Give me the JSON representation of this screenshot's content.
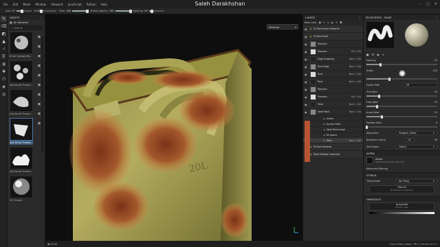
{
  "app": {
    "title": "Saleh Darakhshan",
    "menu": [
      "File",
      "Edit",
      "Mode",
      "Window",
      "Viewport",
      "JavaScript",
      "Python",
      "Help"
    ],
    "window_controls": [
      "–",
      "□",
      "✕"
    ]
  },
  "toolbar": {
    "fields": [
      {
        "label": "Size",
        "value": "27",
        "fill": 0.35
      },
      {
        "label": "",
        "value": "0.00",
        "fill": 0.0
      },
      {
        "label": "Flow",
        "value": "100",
        "fill": 1.0
      },
      {
        "label": "Stroke opacity",
        "value": "100",
        "fill": 1.0
      },
      {
        "label": "Spacing",
        "value": "20",
        "fill": 0.2
      }
    ]
  },
  "tools": [
    "brush-icon",
    "eraser-icon",
    "projection-icon",
    "geometry-fill-icon",
    "smudge-icon",
    "clone-icon",
    "fill-icon",
    "picker-icon",
    "polygon-fill-icon",
    "color-picker-icon",
    "material-picker-icon"
  ],
  "assets": {
    "title": "ASSETS",
    "library": "All libraries",
    "search": "Search",
    "items": [
      {
        "caption": "Brush Sponge Wisps..."
      },
      {
        "caption": "Kyle Brush Presets at..."
      },
      {
        "caption": "Kyle Brush Presets at..."
      },
      {
        "caption": "Kyle Brush Presets at..."
      },
      {
        "caption": "Kyle Brush Presets at..."
      },
      {
        "caption": "02 Chrome"
      }
    ],
    "selected_index": 3
  },
  "viewport": {
    "dropdown": "Material",
    "status_left": "▣ MASK",
    "status_right": "Cache Disk Usage:   78% | Version: 8.3.1"
  },
  "layers": {
    "title": "LAYERS",
    "blend_label": "Base color",
    "rows": [
      {
        "name": "02 Rust Smart Material",
        "blend": "",
        "opacity": "",
        "type": "group"
      },
      {
        "name": "03 Rust Paint",
        "blend": "",
        "opacity": "",
        "type": "group"
      },
      {
        "name": "Sharpen",
        "blend": "",
        "opacity": "",
        "type": "layer"
      },
      {
        "name": "Sharpen",
        "blend": "Mul",
        "opacity": "100",
        "type": "layer"
      },
      {
        "name": "Edge Bubbling",
        "blend": "Norm",
        "opacity": "100",
        "type": "layer"
      },
      {
        "name": "Rust Edge",
        "blend": "Norm",
        "opacity": "100",
        "type": "layer"
      },
      {
        "name": "Rust",
        "blend": "Norm",
        "opacity": "100",
        "type": "layer"
      },
      {
        "name": "Rust",
        "blend": "Norm",
        "opacity": "100",
        "type": "layer"
      },
      {
        "name": "Sharpen",
        "blend": "",
        "opacity": "",
        "type": "layer"
      },
      {
        "name": "Sharpen",
        "blend": "Mul",
        "opacity": "100",
        "type": "layer"
      },
      {
        "name": "Paint",
        "blend": "Norm",
        "opacity": "100",
        "type": "layer"
      },
      {
        "name": "Steel Paint",
        "blend": "Norm",
        "opacity": "100",
        "type": "layer"
      },
      {
        "name": "Levels",
        "blend": "",
        "opacity": "",
        "type": "fx"
      },
      {
        "name": "Anchor Point",
        "blend": "",
        "opacity": "",
        "type": "fx"
      },
      {
        "name": "Steel Paint mask",
        "blend": "",
        "opacity": "",
        "type": "fx"
      },
      {
        "name": "Fill Space",
        "blend": "",
        "opacity": "",
        "type": "fx"
      },
      {
        "name": "Paint",
        "blend": "Norm",
        "opacity": "100",
        "type": "fx"
      },
      {
        "name": "00 Rust General",
        "blend": "",
        "opacity": "",
        "type": "group"
      },
      {
        "name": "Steel Painted Clearcoat",
        "blend": "",
        "opacity": "",
        "type": "group"
      }
    ],
    "selected_index": 16
  },
  "properties": {
    "title": "PROPERTIES - PAINT",
    "params": [
      {
        "label": "Spacing",
        "value": "20",
        "fill": 0.2
      },
      {
        "label": "Angle",
        "value": "120",
        "fill": 0.33
      },
      {
        "label": "Follow Path",
        "value": "Off",
        "fill": null
      },
      {
        "label": "Size Jitter",
        "value": "18",
        "fill": 0.18
      },
      {
        "label": "Flow Jitter",
        "value": "15",
        "fill": 0.15
      },
      {
        "label": "Angle Jitter",
        "value": "22",
        "fill": 0.22
      },
      {
        "label": "Position Jitter",
        "value": "0",
        "fill": 0.0
      }
    ],
    "alignment_label": "Alignment",
    "alignment_value": "Tangent | Wrap",
    "backface_label": "Backface culling",
    "backface_value": "On",
    "backface_num": "90",
    "size_space_label": "Size Space",
    "size_space_value": "Object",
    "alpha_head": "ALPHA",
    "alpha_name": "Alpha",
    "alpha_sub": "Kyle Brush Presets Alpha 7b",
    "advanced": "Advanced filtering",
    "stencil_head": "STENCIL",
    "tiling_label": "Tiling mode",
    "tiling_value": "No Tiling",
    "stencil_btn": "Stencil",
    "stencil_sub": "No Resource Selected",
    "grayscale_head": "GRAYSCALE",
    "grayscale_name": "grayscale",
    "grayscale_sub": "uniform color"
  },
  "colors": {
    "accent_selected": "#3d5a7a",
    "layer_marker": "#b65432",
    "rust": "#a0522d",
    "paint": "#a9a353"
  }
}
